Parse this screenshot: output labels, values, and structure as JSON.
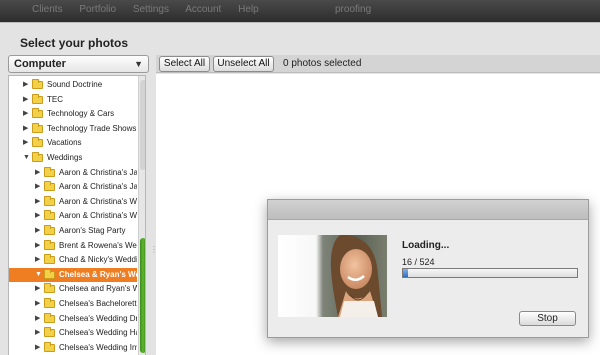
{
  "topbar": {
    "items": [
      "Clients",
      "Portfolio",
      "Settings",
      "Account",
      "Help"
    ],
    "right": "proofing"
  },
  "dialog": {
    "title": "Select your photos"
  },
  "source": {
    "selected": "Computer"
  },
  "tree": {
    "items": [
      {
        "label": "Sound Doctrine",
        "level": 1,
        "expanded": false,
        "selected": false
      },
      {
        "label": "TEC",
        "level": 1,
        "expanded": false,
        "selected": false
      },
      {
        "label": "Technology & Cars",
        "level": 1,
        "expanded": false,
        "selected": false
      },
      {
        "label": "Technology Trade Shows",
        "level": 1,
        "expanded": false,
        "selected": false
      },
      {
        "label": "Vacations",
        "level": 1,
        "expanded": false,
        "selected": false
      },
      {
        "label": "Weddings",
        "level": 1,
        "expanded": true,
        "selected": false
      },
      {
        "label": "Aaron & Christina's Jack &",
        "level": 2,
        "expanded": false,
        "selected": false
      },
      {
        "label": "Aaron & Christina's Jack &",
        "level": 2,
        "expanded": false,
        "selected": false
      },
      {
        "label": "Aaron & Christina's Wedding",
        "level": 2,
        "expanded": false,
        "selected": false
      },
      {
        "label": "Aaron & Christina's Wedding",
        "level": 2,
        "expanded": false,
        "selected": false
      },
      {
        "label": "Aaron's Stag Party",
        "level": 2,
        "expanded": false,
        "selected": false
      },
      {
        "label": "Brent & Rowena's Wedding",
        "level": 2,
        "expanded": false,
        "selected": false
      },
      {
        "label": "Chad & Nicky's Wedding",
        "level": 2,
        "expanded": false,
        "selected": false
      },
      {
        "label": "Chelsea & Ryan's Wedding",
        "level": 2,
        "expanded": true,
        "selected": true
      },
      {
        "label": "Chelsea and Ryan's Wedding",
        "level": 2,
        "expanded": false,
        "selected": false
      },
      {
        "label": "Chelsea's Bachelorette Party",
        "level": 2,
        "expanded": false,
        "selected": false
      },
      {
        "label": "Chelsea's Wedding Dress",
        "level": 2,
        "expanded": false,
        "selected": false
      },
      {
        "label": "Chelsea's Wedding Hair Trial",
        "level": 2,
        "expanded": false,
        "selected": false
      },
      {
        "label": "Chelsea's Wedding Invitations",
        "level": 2,
        "expanded": false,
        "selected": false
      }
    ]
  },
  "toolbar": {
    "select_all": "Select All",
    "unselect_all": "Unselect All",
    "count": "0 photos selected"
  },
  "loader": {
    "title": "Loading...",
    "progress_text": "16 / 524",
    "progress": 0.03,
    "stop_label": "Stop"
  },
  "colors": {
    "selection": "#ef7d22",
    "scroll_thumb": "#4fa226",
    "progress": "#2e6fc2"
  }
}
